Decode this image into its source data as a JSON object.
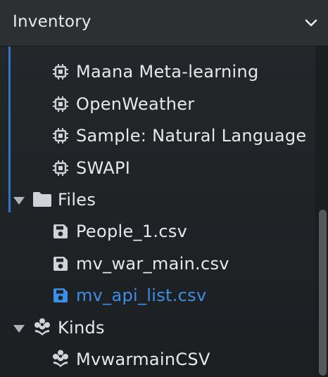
{
  "header": {
    "title": "Inventory",
    "chevron_icon": "chevron-down-icon"
  },
  "tree": {
    "services": [
      {
        "label": "Maana Meta-learning",
        "icon": "chip-icon"
      },
      {
        "label": "OpenWeather",
        "icon": "chip-icon"
      },
      {
        "label": "Sample: Natural Language",
        "icon": "chip-icon"
      },
      {
        "label": "SWAPI",
        "icon": "chip-icon"
      }
    ],
    "files_group": {
      "label": "Files",
      "icon": "folder-icon",
      "expanded": true
    },
    "files": [
      {
        "label": "People_1.csv",
        "icon": "floppy-disk-icon",
        "selected": false
      },
      {
        "label": "mv_war_main.csv",
        "icon": "floppy-disk-icon",
        "selected": false
      },
      {
        "label": "mv_api_list.csv",
        "icon": "floppy-disk-icon",
        "selected": true
      }
    ],
    "kinds_group": {
      "label": "Kinds",
      "icon": "flower-icon",
      "expanded": true
    },
    "kinds": [
      {
        "label": "MvwarmainCSV",
        "icon": "flower-icon"
      }
    ]
  },
  "colors": {
    "selected_text": "#3b8fe6",
    "text": "#e6e9ec",
    "icon": "#d0d4d8",
    "accent_line": "#2f78c7"
  }
}
